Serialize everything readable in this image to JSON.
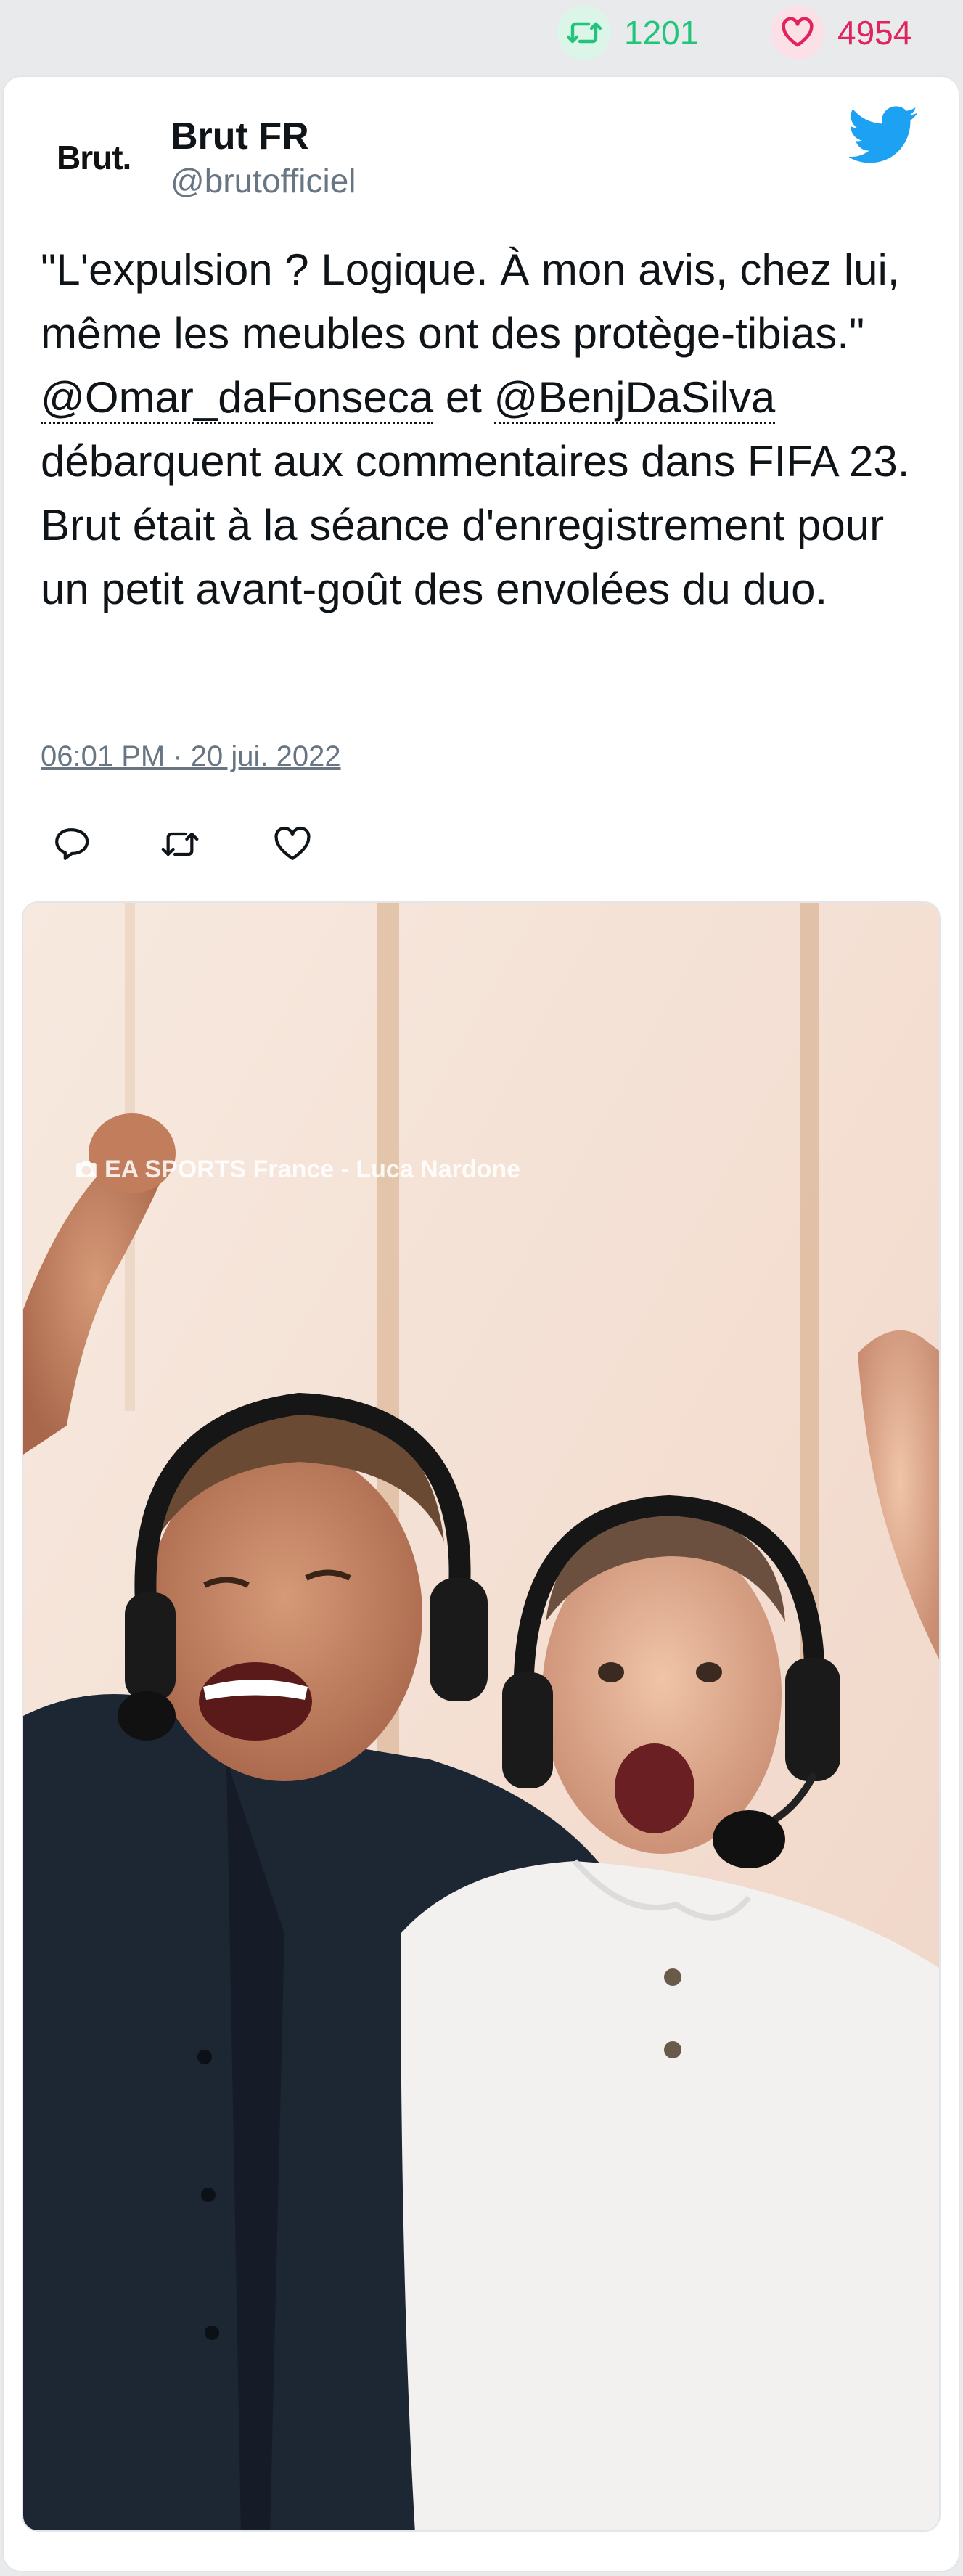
{
  "stats": {
    "retweet_count": "1201",
    "like_count": "4954"
  },
  "author": {
    "logo_text": "Brut.",
    "name": "Brut FR",
    "handle": "@brutofficiel"
  },
  "tweet": {
    "text_part1": "\"L'expulsion ? Logique. À mon avis, chez lui, même les meubles ont des protège-tibias.\" ",
    "mention1": "@Omar_daFonseca",
    "text_part2": " et ",
    "mention2": "@BenjDaSilva",
    "text_part3": " débarquent aux commentaires dans FIFA 23. Brut était à la séance d'enregistrement pour un petit avant-goût des envolées du duo.",
    "timestamp": "06:01 PM · 20 jui. 2022"
  },
  "media": {
    "credit": "EA SPORTS France - Luca Nardone"
  },
  "colors": {
    "retweet_green": "#20c47a",
    "like_red": "#e0245e",
    "twitter_blue": "#1da1f2",
    "muted_text": "#687684"
  },
  "icons": [
    "retweet-icon",
    "heart-icon",
    "twitter-bird-icon",
    "reply-icon",
    "camera-icon"
  ]
}
